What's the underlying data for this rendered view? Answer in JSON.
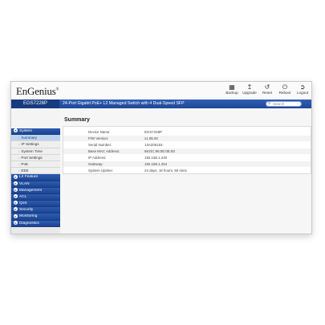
{
  "brand": {
    "logo": "EnGenius",
    "trademark": "®"
  },
  "toolbar": [
    {
      "name": "backup",
      "label": "Backup",
      "icon": "save-icon"
    },
    {
      "name": "upgrade",
      "label": "Upgrade",
      "icon": "upload-icon"
    },
    {
      "name": "reset",
      "label": "Reset",
      "icon": "reset-icon"
    },
    {
      "name": "reboot",
      "label": "Reboot",
      "icon": "power-icon"
    },
    {
      "name": "logout",
      "label": "Logout",
      "icon": "logout-icon"
    }
  ],
  "header": {
    "model": "EGS7228P",
    "description": "24-Port Gigabit PoE+ L2 Managed Switch with 4 Dual-Speed SFP",
    "search_placeholder": "Search"
  },
  "sidebar": {
    "system": "System",
    "system_items": [
      "Summary",
      "IP Settings",
      "System Time",
      "Port Settings",
      "PoE",
      "EEE"
    ],
    "active_item": "Summary",
    "sections": [
      "L2 Feature",
      "VLAN",
      "Management",
      "ACL",
      "QoS",
      "Security",
      "Monitoring",
      "Diagnostics"
    ]
  },
  "main": {
    "title": "Summary",
    "rows": [
      {
        "label": "Device Name:",
        "value": "EGS7228P"
      },
      {
        "label": "F/W Version:",
        "value": "v1.05.00"
      },
      {
        "label": "Serial Number:",
        "value": "13A205163"
      },
      {
        "label": "Base MAC Address:",
        "value": "88:DC:96:0E:0E:93"
      },
      {
        "label": "IP Address:",
        "value": "192.168.1.240"
      },
      {
        "label": "Gateway:",
        "value": "192.168.1.254"
      },
      {
        "label": "System Uptime:",
        "value": "24 days, 16 hours, 50 mins"
      }
    ]
  },
  "colors": {
    "accent": "#1f4695",
    "active_item": "#bcd3ef"
  }
}
